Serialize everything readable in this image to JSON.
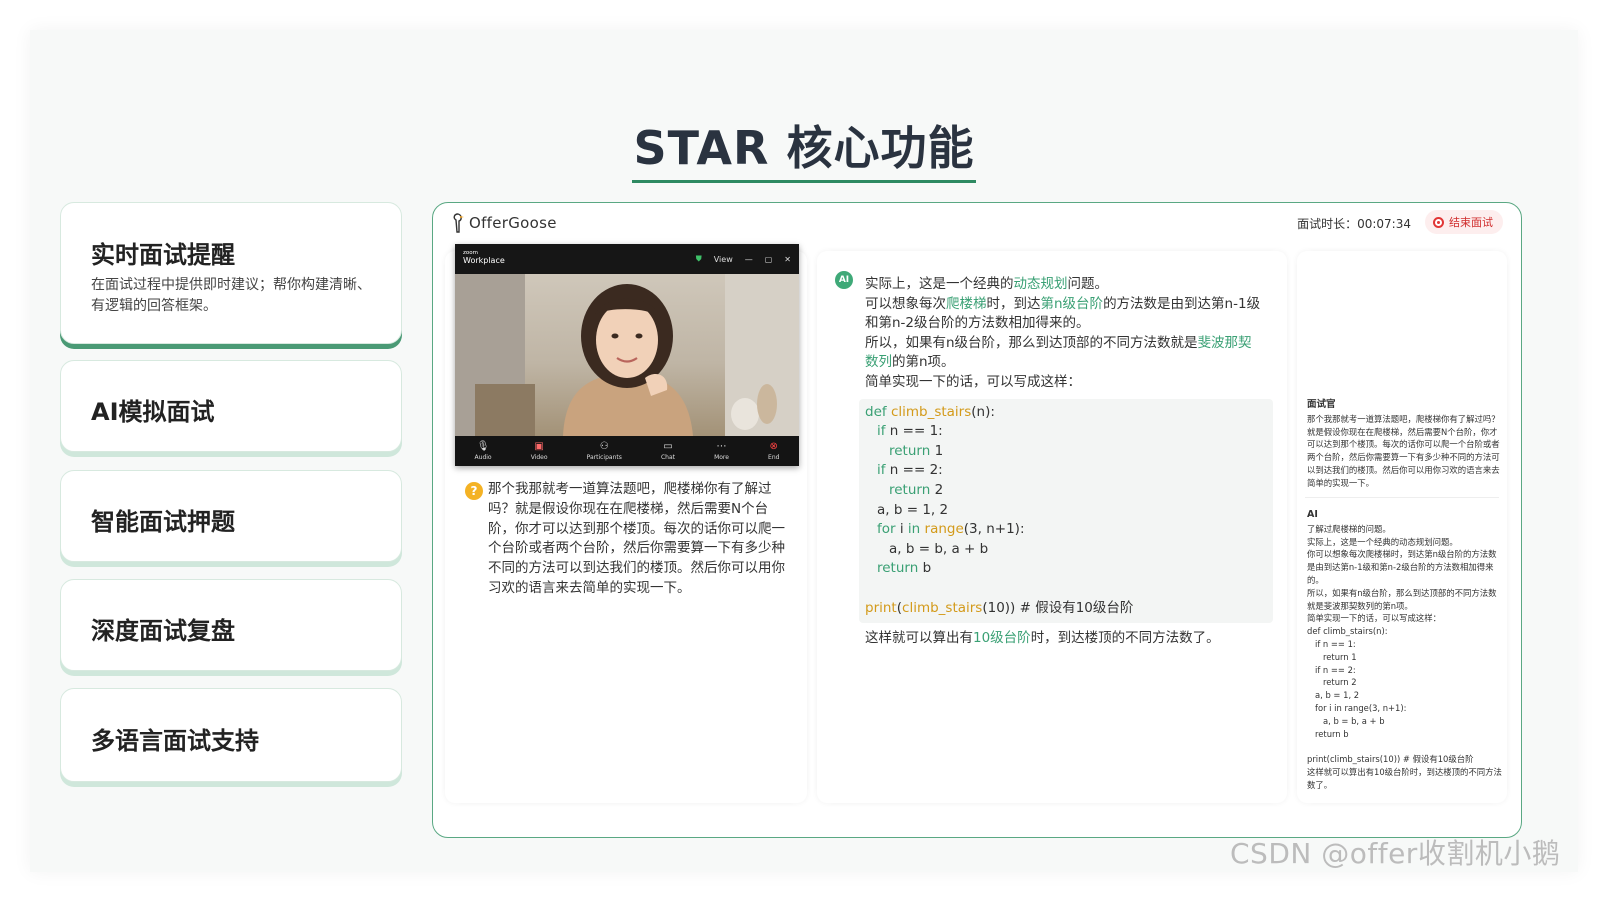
{
  "page": {
    "title": "STAR 核心功能",
    "watermark": "CSDN @offer收割机小鹅"
  },
  "features": [
    {
      "name": "实时面试提醒",
      "desc": "在面试过程中提供即时建议；帮你构建清晰、有逻辑的回答框架。",
      "active": true
    },
    {
      "name": "AI模拟面试"
    },
    {
      "name": "智能面试押题"
    },
    {
      "name": "深度面试复盘"
    },
    {
      "name": "多语言面试支持"
    }
  ],
  "app": {
    "brand": "OfferGoose",
    "timer_label": "面试时长：",
    "timer_value": "00:07:34",
    "end_button": "结束面试",
    "video": {
      "brand_small": "zoom",
      "brand_name": "Workplace",
      "view_label": "View",
      "controls": [
        "Audio",
        "Video",
        "Participants",
        "Chat",
        "More",
        "End"
      ]
    },
    "question": "那个我那就考一道算法题吧，爬楼梯你有了解过吗？就是假设你现在在爬楼梯，然后需要N个台阶，你才可以达到那个楼顶。每次的话你可以爬一个台阶或者两个台阶，然后你需要算一下有多少种不同的方法可以到达我们的楼顶。然后你可以用你习欢的语言来去简单的实现一下。",
    "answer": {
      "icon_label": "AI",
      "p1_a": "实际上，这是一个经典的",
      "p1_hl": "动态规划",
      "p1_b": "问题。",
      "p2_a": "可以想象每次",
      "p2_hl1": "爬楼梯",
      "p2_b": "时，到达",
      "p2_hl2": "第n级台阶",
      "p2_c": "的方法数是由到达第n-1级和第n-2级台阶的方法数相加得来的。",
      "p3_a": "所以，如果有n级台阶，那么到达顶部的不同方法数就是",
      "p3_hl": "斐波那契数列",
      "p3_b": "的第n项。",
      "p4": "简单实现一下的话，可以写成这样：",
      "code": {
        "def": "def",
        "fname": "climb_stairs",
        "fparams": "(n):",
        "if1": "if",
        "cond1": " n == 1:",
        "ret1_kw": "return",
        "ret1_v": " 1",
        "if2": "if",
        "cond2": " n == 2:",
        "ret2_kw": "return",
        "ret2_v": " 2",
        "assign": "a, b = 1, 2",
        "for_kw": "for",
        "for_mid": " i ",
        "in_kw": "in",
        "range_fn": "range",
        "range_args": "(3, n+1):",
        "loop_body": "a, b = b, a + b",
        "ret3_kw": "return",
        "ret3_v": " b",
        "print_fn": "print",
        "print_open": "(",
        "print_inner": "climb_stairs",
        "print_args": "(10))",
        "print_comment": "  # 假设有10级台阶"
      },
      "after_a": "这样就可以算出有",
      "after_hl": "10级台阶",
      "after_b": "时，到达楼顶的不同方法数了。"
    },
    "transcript": {
      "interviewer_label": "面试官",
      "interviewer_text": "那个我那就考一道算法题吧，爬楼梯你有了解过吗？就是假设你现在在爬楼梯，然后需要N个台阶，你才可以达到那个楼顶。每次的话你可以爬一个台阶或者两个台阶，然后你需要算一下有多少种不同的方法可以到达我们的楼顶。然后你可以用你习欢的语言来去简单的实现一下。",
      "ai_label": "AI",
      "ai_lines": [
        "了解过爬楼梯的问题。",
        "实际上，这是一个经典的动态规划问题。",
        "你可以想象每次爬楼梯时，到达第n级台阶的方法数是由到达第n-1级和第n-2级台阶的方法数相加得来的。",
        "所以，如果有n级台阶，那么到达顶部的不同方法数就是斐波那契数列的第n项。",
        "简单实现一下的话，可以写成这样：",
        "def climb_stairs(n):",
        "    if n == 1:",
        "        return 1",
        "    if n == 2:",
        "        return 2",
        "    a, b = 1, 2",
        "    for i in range(3, n+1):",
        "        a, b = b, a + b",
        "    return b",
        "",
        "print(climb_stairs(10))  # 假设有10级台阶",
        "这样就可以算出有10级台阶时，到达楼顶的不同方法数了。"
      ]
    }
  },
  "colors": {
    "accent": "#3aa074",
    "underline": "#2e8a62",
    "end_red": "#e13636"
  }
}
